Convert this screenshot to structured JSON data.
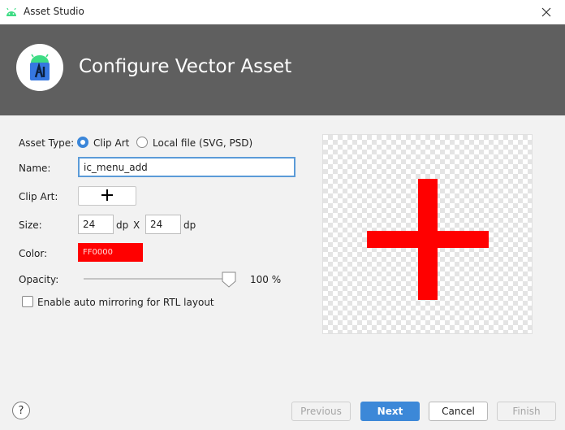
{
  "window": {
    "title": "Asset Studio",
    "app_icon": "android-icon",
    "close_icon": "close-icon"
  },
  "header": {
    "title": "Configure Vector Asset",
    "logo_icon": "android-studio-logo-icon"
  },
  "form": {
    "asset_type_label": "Asset Type:",
    "asset_type_options": [
      {
        "label": "Clip Art",
        "selected": true
      },
      {
        "label": "Local file (SVG, PSD)",
        "selected": false
      }
    ],
    "name_label": "Name:",
    "name_value": "ic_menu_add",
    "clip_art_label": "Clip Art:",
    "clip_art_icon": "plus-icon",
    "size_label": "Size:",
    "width_value": "24",
    "height_value": "24",
    "unit_dp": "dp",
    "size_separator": "X",
    "color_label": "Color:",
    "color_value": "FF0000",
    "color_hex": "#FF0000",
    "opacity_label": "Opacity:",
    "opacity_value": "100 %",
    "opacity_fraction": 1.0,
    "rtl_checkbox_label": "Enable auto mirroring for RTL layout",
    "rtl_checked": false
  },
  "preview": {
    "icon": "plus-icon",
    "background": "transparency-checkerboard",
    "fill_color": "#FF0000"
  },
  "footer": {
    "help_label": "?",
    "previous_label": "Previous",
    "next_label": "Next",
    "cancel_label": "Cancel",
    "finish_label": "Finish"
  },
  "colors": {
    "accent": "#3C88D8",
    "header_bg": "#5F5F5F"
  }
}
